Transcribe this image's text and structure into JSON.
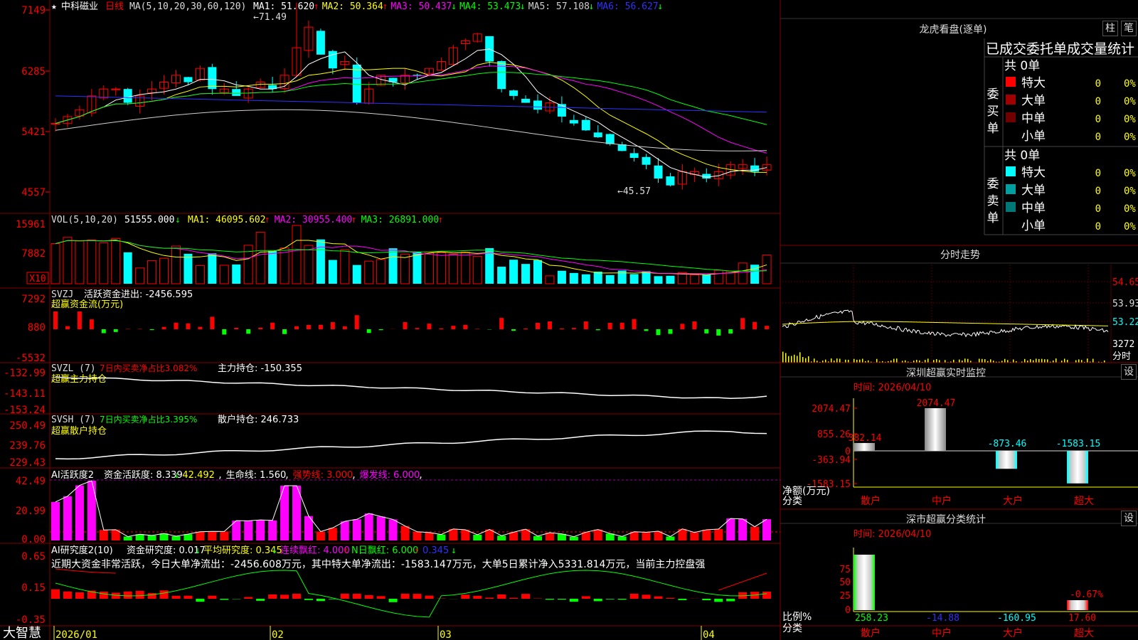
{
  "colors": {
    "up": "#ff0000",
    "down": "#00ffff",
    "ma1": "#ffffff",
    "ma2": "#ffff00",
    "ma3": "#ff00ff",
    "ma4": "#00ff00",
    "ma5": "#d0d0d0",
    "ma6": "#3030ff",
    "green": "#00ff00",
    "magenta": "#ff00ff",
    "grid": "#800000"
  },
  "kline": {
    "star": "★",
    "stock": "中科磁业",
    "period": "日线",
    "ma_spec": "MA(5,10,20,30,60,120)",
    "ma_items": [
      {
        "label": "MA1: 51.620",
        "arrow": "↑",
        "color": "#ffffff",
        "acolor": "#ff0000"
      },
      {
        "label": "MA2: 50.364",
        "arrow": "↑",
        "color": "#ffff00",
        "acolor": "#ff0000"
      },
      {
        "label": "MA3: 50.437",
        "arrow": "↓",
        "color": "#ff00ff",
        "acolor": "#00ff00"
      },
      {
        "label": "MA4: 53.473",
        "arrow": "↓",
        "color": "#00ff00",
        "acolor": "#00ff00"
      },
      {
        "label": "MA5: 57.108",
        "arrow": "↓",
        "color": "#d0d0d0",
        "acolor": "#00ff00"
      },
      {
        "label": "MA6: 56.627",
        "arrow": "↓",
        "color": "#3030ff",
        "acolor": "#00ff00"
      }
    ],
    "y_labels": [
      "7149",
      "6285",
      "5421",
      "4557"
    ],
    "high_label": "71.49",
    "low_label": "45.57"
  },
  "vol": {
    "spec": "VOL(5,10,20)",
    "value": "51555.000",
    "arrow": "↓",
    "ma_items": [
      {
        "label": "MA1: 46095.602",
        "arrow": "↑",
        "color": "#ffff00"
      },
      {
        "label": "MA2: 30955.400",
        "arrow": "↑",
        "color": "#ff00ff"
      },
      {
        "label": "MA3: 26891.000",
        "arrow": "↑",
        "color": "#00ff00"
      }
    ],
    "y_labels": [
      "15961",
      "7882"
    ],
    "unit": "X10"
  },
  "svzj": {
    "name": "SVZJ",
    "label": "活跃资金进出: -2456.595",
    "arrow": "↓",
    ",": ",",
    "sub": "超赢资金流(万元)",
    "y_labels": [
      "7292",
      "880",
      "-5532"
    ]
  },
  "svzl": {
    "name": "SVZL (7)",
    "pct": "7日内买卖净占比3.082%",
    "label": "主力持仓: -150.355",
    "arrow": "↓",
    "sub": "超赢主力持仓",
    "y_labels": [
      "-132.99",
      "-143.11",
      "-153.24"
    ]
  },
  "svsh": {
    "name": "SVSH (7)",
    "pct": "7日内买卖净占比3.395%",
    "label": "散户持仓: 246.733",
    "arrow": "↑",
    "sub": "超赢散户持仓",
    "y_labels": [
      "250.49",
      "239.76",
      "229.43"
    ]
  },
  "ai1": {
    "name": "AI活跃度2",
    "items": [
      {
        "t": "资金活跃度: 8.339",
        "a": "↓",
        "c": "#ffffff"
      },
      {
        "t": "42.492",
        "a": ",",
        "c": "#ffff00"
      },
      {
        "t": "生命线: 1.560",
        "a": ",",
        "c": "#ffffff"
      },
      {
        "t": "强势线: 3.000",
        "a": ",",
        "c": "#ff0000"
      },
      {
        "t": "爆发线: 6.000",
        "a": ",",
        "c": "#ff00ff"
      }
    ],
    "y_labels": [
      "42.49",
      "20.99",
      "0.00"
    ]
  },
  "ai2": {
    "name": "AI研究度2(10)",
    "items": [
      {
        "t": "资金研究度: 0.017",
        "a": "↓",
        "c": "#ffffff"
      },
      {
        "t": "平均研究度: 0.345",
        "a": "↓",
        "c": "#ffff00"
      },
      {
        "t": "连续飘红: 4.000",
        "a": "↑",
        "c": "#ff00ff"
      },
      {
        "t": "N日飘红: 6.000",
        "a": "↑",
        "c": "#00ff00"
      },
      {
        "t": "0.345",
        "a": "↓",
        "c": "#3030ff"
      }
    ],
    "note": "近期大资金非常活跃，今日大单净流出：-2456.608万元，其中特大单净流出：-1583.147万元，大单5日累计净入5331.814万元，当前主力控盘强",
    "y_labels": [
      "0.65",
      "0.15",
      "-0.35"
    ]
  },
  "x_axis": {
    "labels": [
      "2026/01",
      "02",
      "03",
      "04"
    ]
  },
  "brand": "大智慧",
  "right": {
    "lhb": {
      "title": "龙虎看盘(逐单)",
      "btn1": "柱",
      "btn2": "笔",
      "stat_title": "已成交委托单成交量统计",
      "buy": {
        "side": "委买单",
        "total": "共 0单",
        "rows": [
          {
            "name": "特大",
            "v": "0",
            "p": "0%",
            "c": "#ff0000"
          },
          {
            "name": "大单",
            "v": "0",
            "p": "0%",
            "c": "#a00000"
          },
          {
            "name": "中单",
            "v": "0",
            "p": "0%",
            "c": "#700000"
          },
          {
            "name": "小单",
            "v": "0",
            "p": "0%",
            "c": "#000000"
          }
        ]
      },
      "sell": {
        "side": "委卖单",
        "total": "共 0单",
        "rows": [
          {
            "name": "特大",
            "v": "0",
            "p": "0%",
            "c": "#00ffff"
          },
          {
            "name": "大单",
            "v": "0",
            "p": "0%",
            "c": "#00a0a0"
          },
          {
            "name": "中单",
            "v": "0",
            "p": "0%",
            "c": "#007878"
          },
          {
            "name": "小单",
            "v": "0",
            "p": "0%",
            "c": "#000000"
          }
        ]
      }
    },
    "fst": {
      "title": "分时走势",
      "y_labels": [
        "54.65",
        "53.93",
        "53.22"
      ],
      "vol_label": "3272",
      "unit": "分时"
    },
    "monitor": {
      "title": "深圳超赢实时监控",
      "btn": "设",
      "date": "时间: 2026/04/10",
      "y_labels": [
        "2074.47",
        "855.26",
        "0",
        "-363.94",
        "-1583.15"
      ],
      "bars": [
        {
          "name": "散户",
          "val": "382.14",
          "v": 382.14
        },
        {
          "name": "中户",
          "val": "2074.47",
          "v": 2074.47
        },
        {
          "name": "大户",
          "val": "-873.46",
          "v": -873.46
        },
        {
          "name": "超大",
          "val": "-1583.15",
          "v": -1583.15
        }
      ],
      "ylab": "净额(万元)",
      "xlab": "分类"
    },
    "stat": {
      "title": "深市超赢分类统计",
      "btn": "设",
      "date": "时间: 2026/04/10",
      "y_labels": [
        "75",
        "50",
        "25",
        "0"
      ],
      "bars": [
        {
          "name": "散户",
          "val": "258.23",
          "v": 258.23,
          "c": "#00ff00"
        },
        {
          "name": "中户",
          "val": "-14.88",
          "v": -14.88,
          "c": "#3030ff"
        },
        {
          "name": "大户",
          "val": "-160.95",
          "v": -160.95,
          "c": "#00ffff"
        },
        {
          "name": "超大",
          "val": "17.60",
          "v": 17.6,
          "c": "#ff0000"
        }
      ],
      "extra": "-0.67%",
      "ylab": "比例%",
      "xlab": "分类"
    }
  }
}
